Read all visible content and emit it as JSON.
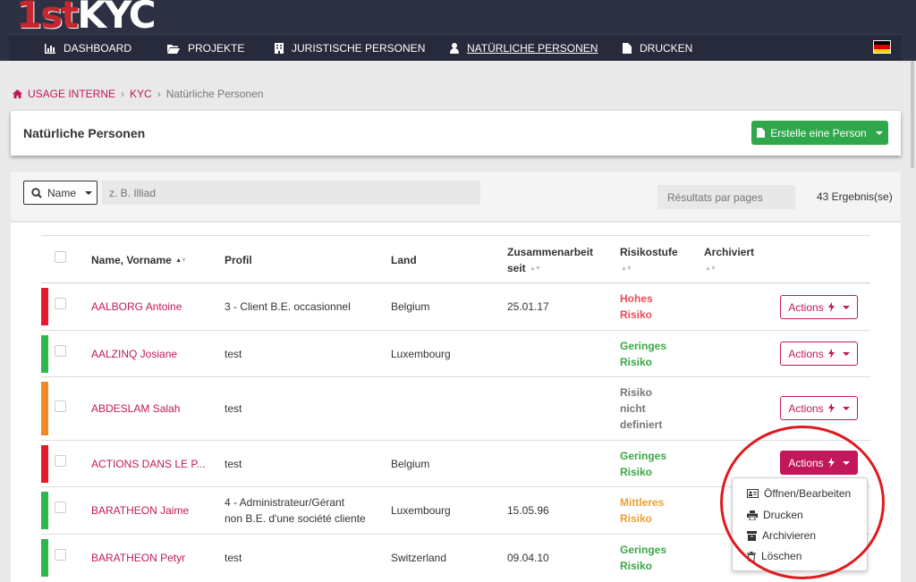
{
  "app": {
    "logo_part1": "1st",
    "logo_part2": "KYC"
  },
  "nav": {
    "items": [
      {
        "label": "DASHBOARD",
        "icon": "bar-chart-icon"
      },
      {
        "label": "PROJEKTE",
        "icon": "folder-open-icon"
      },
      {
        "label": "JURISTISCHE PERSONEN",
        "icon": "building-icon"
      },
      {
        "label": "NATÜRLICHE PERSONEN",
        "icon": "user-icon",
        "active": true
      },
      {
        "label": "DRUCKEN",
        "icon": "file-icon"
      }
    ],
    "language_flag": "german-flag-icon"
  },
  "breadcrumb": {
    "home": "USAGE INTERNE",
    "second": "KYC",
    "current": "Natürliche Personen"
  },
  "page": {
    "title": "Natürliche Personen",
    "create_button": "Erstelle eine Person"
  },
  "filter": {
    "field_select": "Name",
    "search_placeholder": "z. B. Illiad",
    "per_page_placeholder": "Résultats par pages",
    "result_count": "43 Ergebnis(se)"
  },
  "table": {
    "headers": {
      "name": "Name, Vorname",
      "profil": "Profil",
      "land": "Land",
      "zusammenarbeit_1": "Zusammenarbeit",
      "zusammenarbeit_2": "seit",
      "risikostufe": "Risikostufe",
      "archiviert": "Archiviert"
    },
    "action_label": "Actions",
    "rows": [
      {
        "name": "AALBORG Antoine",
        "profil_1": "3 - Client B.E. occasionnel",
        "profil_2": "",
        "land": "Belgium",
        "since": "25.01.17",
        "risk_1": "Hohes",
        "risk_2": "Risiko",
        "risk_3": "",
        "risk_color": "#e84c5a",
        "bar_color": "#e8192c"
      },
      {
        "name": "AALZINQ Josiane",
        "profil_1": "test",
        "profil_2": "",
        "land": "Luxembourg",
        "since": "",
        "risk_1": "Geringes",
        "risk_2": "Risiko",
        "risk_3": "",
        "risk_color": "#3aa845",
        "bar_color": "#2db84d"
      },
      {
        "name": "ABDESLAM Salah",
        "profil_1": "test",
        "profil_2": "",
        "land": "",
        "since": "",
        "risk_1": "Risiko",
        "risk_2": "nicht",
        "risk_3": "definiert",
        "risk_color": "#777777",
        "bar_color": "#f08a24"
      },
      {
        "name": "ACTIONS DANS LE P...",
        "profil_1": "test",
        "profil_2": "",
        "land": "Belgium",
        "since": "",
        "risk_1": "Geringes",
        "risk_2": "Risiko",
        "risk_3": "",
        "risk_color": "#3aa845",
        "bar_color": "#e8192c"
      },
      {
        "name": "BARATHEON Jaime",
        "profil_1": "4 - Administrateur/Gérant",
        "profil_2": "non B.E. d'une société cliente",
        "land": "Luxembourg",
        "since": "15.05.96",
        "risk_1": "Mittleres",
        "risk_2": "Risiko",
        "risk_3": "",
        "risk_color": "#f0a030",
        "bar_color": "#2db84d"
      },
      {
        "name": "BARATHEON Petyr",
        "profil_1": "test",
        "profil_2": "",
        "land": "Switzerland",
        "since": "09.04.10",
        "risk_1": "Geringes",
        "risk_2": "Risiko",
        "risk_3": "",
        "risk_color": "#3aa845",
        "bar_color": "#2db84d"
      }
    ]
  },
  "dropdown_menu": {
    "items": [
      {
        "label": "Öffnen/Bearbeiten",
        "icon": "id-card-icon"
      },
      {
        "label": "Drucken",
        "icon": "printer-icon"
      },
      {
        "label": "Archivieren",
        "icon": "archive-icon"
      },
      {
        "label": "Löschen",
        "icon": "trash-icon"
      }
    ]
  },
  "colors": {
    "brand": "#c2185b",
    "navbar": "#2d3143",
    "success": "#2ea84a",
    "highlight_ellipse": "#e0191f"
  }
}
